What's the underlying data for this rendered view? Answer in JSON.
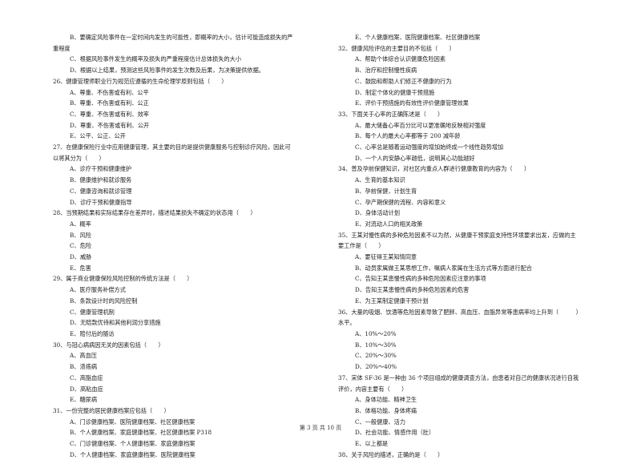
{
  "left_column": {
    "continuation": {
      "options": [
        {
          "label": "B",
          "text": "要确定风险事件在一定时间内发生的可能性，即概率的大小，估计可能造成损失的严",
          "wrap": "重程度"
        },
        {
          "label": "C",
          "text": "根据风险事件发生的概率及损失的严重程度估计总体损失的大小"
        },
        {
          "label": "D",
          "text": "根据以上结果，预测这些风险事件的发生次数及后果，为决策提供依据。"
        }
      ]
    },
    "questions": [
      {
        "number": "26",
        "stem": "健康管理师职业行为规范应遵循的生命伦理学原则包括（　　）",
        "options": [
          {
            "label": "A",
            "text": "尊重、不伤害或有利、公平"
          },
          {
            "label": "B",
            "text": "尊重、不伤害或有利、公正"
          },
          {
            "label": "C",
            "text": "尊重、不伤害或有利、效率"
          },
          {
            "label": "D",
            "text": "尊重、不伤害或有利、公开"
          },
          {
            "label": "E",
            "text": "公平、公正、公开"
          }
        ]
      },
      {
        "number": "27",
        "stem": "在健康保险行业中应用健康管理，其主要的目的是提供健康服务与控制诊疗风险，因此可",
        "stem_wrap": "以将其分为（　　）",
        "options": [
          {
            "label": "A",
            "text": "诊疗干预和健康维护"
          },
          {
            "label": "B",
            "text": "健康维护和就诊服务"
          },
          {
            "label": "C",
            "text": "健康咨询和就诊管理"
          },
          {
            "label": "D",
            "text": "诊疗干预和健康指导"
          }
        ]
      },
      {
        "number": "28",
        "stem": "当预期结果和实际结果存在差异时，描述结果损失不确定的状态用（　　）",
        "options": [
          {
            "label": "A",
            "text": "概率"
          },
          {
            "label": "B",
            "text": "风险"
          },
          {
            "label": "C",
            "text": "危险"
          },
          {
            "label": "D",
            "text": "威胁"
          },
          {
            "label": "E",
            "text": "危害"
          }
        ]
      },
      {
        "number": "29",
        "stem": "属于商业健康保险风险控制的传统方法是（　　）",
        "options": [
          {
            "label": "A",
            "text": "医疗服务补偿方式"
          },
          {
            "label": "B",
            "text": "条款设计时的风险控制"
          },
          {
            "label": "C",
            "text": "健康管理机制"
          },
          {
            "label": "D",
            "text": "无赔款优待和其他利润分享措施"
          },
          {
            "label": "E",
            "text": "赔付后的随访"
          }
        ]
      },
      {
        "number": "30",
        "stem": "与冠心病病因无关的因素包括（　　）",
        "options": [
          {
            "label": "A",
            "text": "高血压"
          },
          {
            "label": "B",
            "text": "溃疡病"
          },
          {
            "label": "C",
            "text": "高脂血症"
          },
          {
            "label": "D",
            "text": "高粘血症"
          },
          {
            "label": "E",
            "text": "糖尿病"
          }
        ]
      },
      {
        "number": "31",
        "stem": "一份完整的居民健康档案应包括（　　）",
        "options": [
          {
            "label": "A",
            "text": "门诊健康档案、医院健康档案、社区健康档案"
          },
          {
            "label": "B",
            "text": "个人健康档案、家庭健康档案、社区健康档案 P318"
          },
          {
            "label": "C",
            "text": "门诊健康档案、个人健康档案、家庭健康档案"
          },
          {
            "label": "D",
            "text": "个人健康档案、家庭健康档案、医院健康档案"
          }
        ]
      }
    ]
  },
  "right_column": {
    "continuation": {
      "options": [
        {
          "label": "E",
          "text": "个人健康档案、医院健康档案、社区健康档案"
        }
      ]
    },
    "questions": [
      {
        "number": "32",
        "stem": "健康风险评估的主要目的不包括（　　）",
        "options": [
          {
            "label": "A",
            "text": "帮助个体综合认识健康危险因素"
          },
          {
            "label": "B",
            "text": "治疗和控制慢性疾病"
          },
          {
            "label": "C",
            "text": "鼓励和帮助人们修正不健康的行为"
          },
          {
            "label": "D",
            "text": "制定个体化的健康干预措施"
          },
          {
            "label": "E",
            "text": "评价干预措施的有效性评价健康管理效果"
          }
        ]
      },
      {
        "number": "33",
        "stem": "下面关于心率的正确陈述是（　　）",
        "options": [
          {
            "label": "A",
            "text": "最大储备心率百分比可以更准确地反映相对强度"
          },
          {
            "label": "B",
            "text": "每个人的最大心率都等于 200 减年龄"
          },
          {
            "label": "C",
            "text": "心率总是随着运动强度的增加始终成一个线性趋势增加"
          },
          {
            "label": "D",
            "text": "一个人的安静心率越低，说明其心功能越好"
          }
        ]
      },
      {
        "number": "34",
        "stem": "普及孕前保健知识，对社区内重点人群进行健康教育的内容为（　　）",
        "options": [
          {
            "label": "A",
            "text": "生育的基本知识"
          },
          {
            "label": "B",
            "text": "孕前保健，计划生育"
          },
          {
            "label": "C",
            "text": "孕产期保健的流程、内容和意义"
          },
          {
            "label": "D",
            "text": "身体活动计划"
          },
          {
            "label": "E",
            "text": "对流动人口的相关政策"
          }
        ]
      },
      {
        "number": "35",
        "stem": "王某对慢性病的多种危险因素不以为然，从健康干预家庭支持性环境要求出发，应做的主",
        "stem_wrap": "要工作是（　　）",
        "options": [
          {
            "label": "A",
            "text": "要征得王某知情同意"
          },
          {
            "label": "B",
            "text": "动员家属做王某思想工作，嘱病人家属在生活方式等方面进行配合"
          },
          {
            "label": "C",
            "text": "告知王某患慢性病的多种危险因素应注意的事项"
          },
          {
            "label": "D",
            "text": "告知王某患慢性病的多种危险因素的危害"
          },
          {
            "label": "E",
            "text": "为王某制定健康干预计划"
          }
        ]
      },
      {
        "number": "36",
        "stem": "大量的吸烟、饮酒等危险因素导致了肥胖、高血压、血脂异常等患病率均上升到（　　　）",
        "stem_wrap": "水平。",
        "options": [
          {
            "label": "A",
            "text": "10%～20%"
          },
          {
            "label": "B",
            "text": "10%～30%"
          },
          {
            "label": "C",
            "text": "20%～30%"
          },
          {
            "label": "D",
            "text": "20%～40%"
          }
        ]
      },
      {
        "number": "37",
        "stem": "宋体 SF-36 是一种由 36 个项目组成的健康调查方法，由患者对自己的健康状况进行自我",
        "stem_wrap": "评价，内容主要有（　　）",
        "options": [
          {
            "label": "A",
            "text": "身体功能、精神卫生"
          },
          {
            "label": "B",
            "text": "体格功能、身体疼痛"
          },
          {
            "label": "C",
            "text": "一般健康、活力"
          },
          {
            "label": "D",
            "text": "社会功能、情感作用（肚）"
          },
          {
            "label": "E",
            "text": "以上都是"
          }
        ]
      },
      {
        "number": "38",
        "stem": "关于风险的描述，正确的是（　　）",
        "options": []
      }
    ]
  },
  "footer": {
    "page_indicator": "第 3 页 共 10 页"
  }
}
